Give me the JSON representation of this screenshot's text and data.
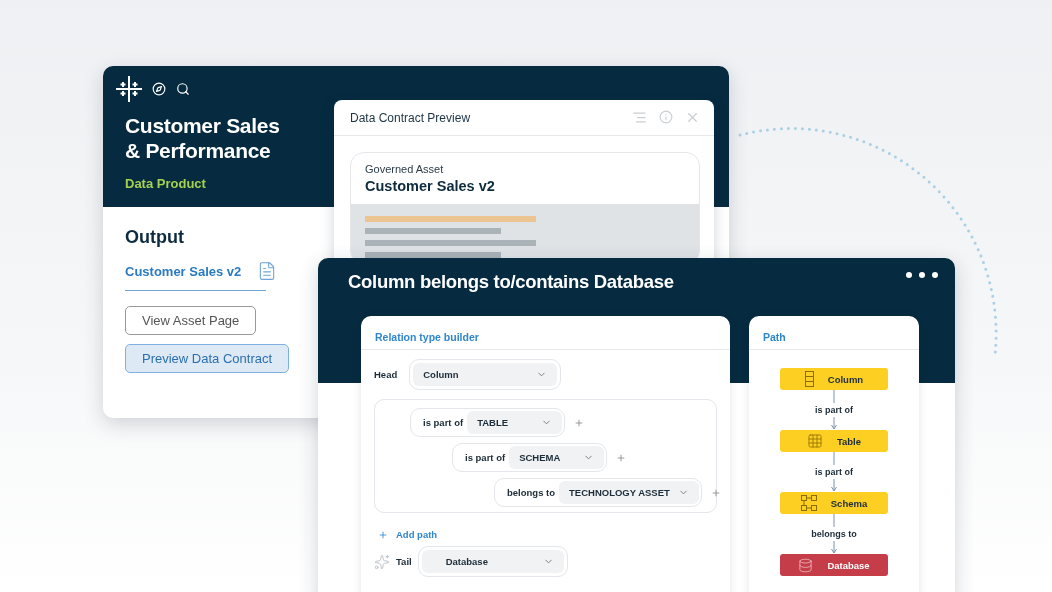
{
  "product_card": {
    "title": "Customer Sales & Performance",
    "subtitle": "Data Product",
    "section_title": "Output",
    "output_link": "Customer Sales v2",
    "buttons": [
      {
        "label": "View Asset Page",
        "kind": "outline"
      },
      {
        "label": "Preview Data Contract",
        "kind": "primary"
      }
    ]
  },
  "preview_window": {
    "title": "Data Contract Preview",
    "asset_label": "Governed Asset",
    "asset_name": "Customer Sales v2"
  },
  "relation_window": {
    "title": "Column belongs to/contains Database",
    "builder": {
      "title": "Relation type builder",
      "head_label": "Head",
      "head_value": "Column",
      "steps": [
        {
          "relation": "is part of",
          "target": "TABLE",
          "children": [
            {
              "relation": "is part of",
              "target": "SCHEMA",
              "children": [
                {
                  "relation": "belongs to",
                  "target": "TECHNOLOGY ASSET"
                }
              ]
            }
          ]
        }
      ],
      "add_path": "Add path",
      "tail_label": "Tail",
      "tail_value": "Database"
    },
    "path_panel": {
      "title": "Path",
      "nodes": [
        {
          "label": "Column",
          "kind": "column",
          "color": "#fccf22",
          "link": "is part of"
        },
        {
          "label": "Table",
          "kind": "table",
          "color": "#fccf22",
          "link": "is part of"
        },
        {
          "label": "Schema",
          "kind": "schema",
          "color": "#fccf22",
          "link": "belongs to"
        },
        {
          "label": "Database",
          "kind": "database",
          "color": "#c63d4a"
        }
      ]
    }
  }
}
